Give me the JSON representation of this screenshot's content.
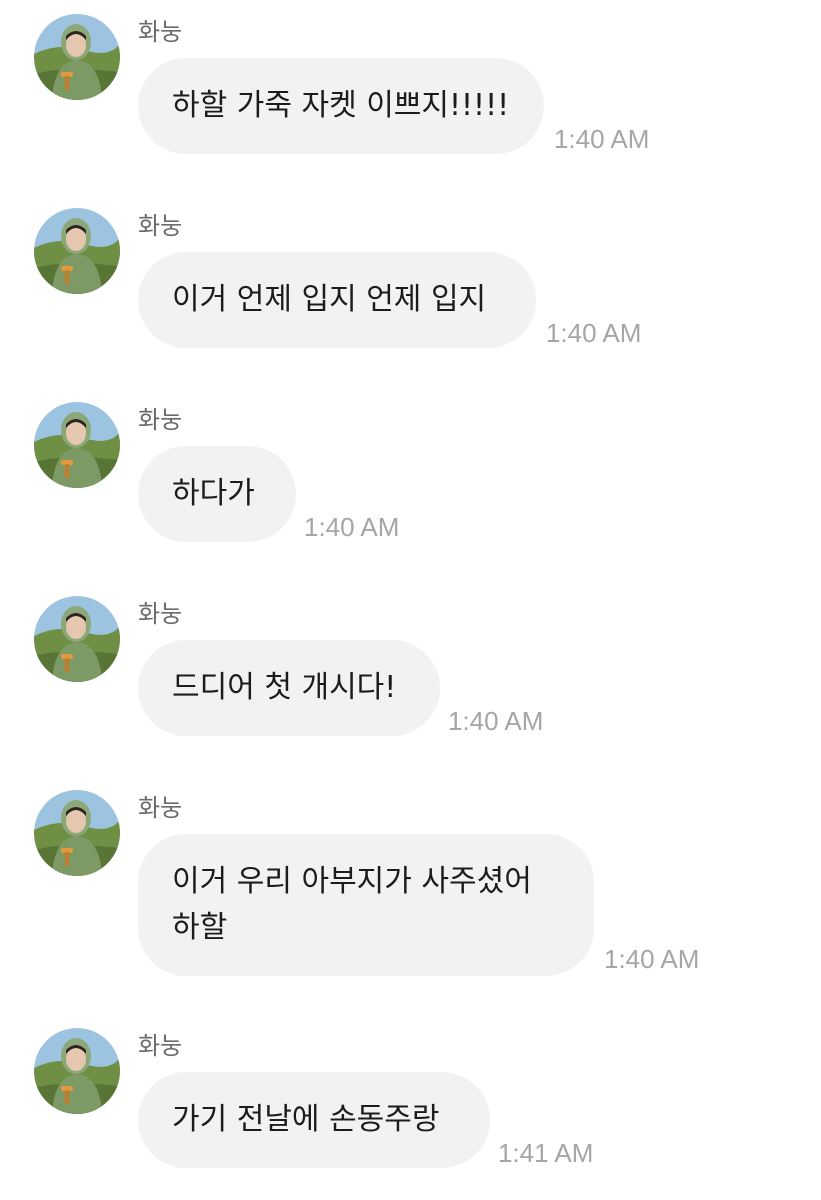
{
  "chat": {
    "messages": [
      {
        "sender": "화눙",
        "lines": [
          "하할 가죽 자켓 이쁘지!!!!!"
        ],
        "time": "1:40 AM"
      },
      {
        "sender": "화눙",
        "lines": [
          "이거 언제 입지 언제 입지"
        ],
        "time": "1:40 AM"
      },
      {
        "sender": "화눙",
        "lines": [
          "하다가"
        ],
        "time": "1:40 AM"
      },
      {
        "sender": "화눙",
        "lines": [
          "드디어 첫 개시다!"
        ],
        "time": "1:40 AM"
      },
      {
        "sender": "화눙",
        "lines": [
          "이거 우리 아부지가 사주셨어",
          "하할"
        ],
        "time": "1:40 AM"
      },
      {
        "sender": "화눙",
        "lines": [
          "가기 전날에 손동주랑"
        ],
        "time": "1:41 AM"
      }
    ]
  },
  "avatar": {
    "icon": "profile-photo-avatar",
    "colors": {
      "sky": "#9cc3e0",
      "hill": "#6f8f45",
      "hoodie": "#7d9a66",
      "skin": "#e6c8b0",
      "hair": "#2b2420",
      "accent": "#e29a3c"
    }
  },
  "colors": {
    "bubble_bg": "#f2f2f4",
    "text": "#1c1c1c",
    "sender": "#6b6b6b",
    "timestamp": "#a5a5aa"
  }
}
